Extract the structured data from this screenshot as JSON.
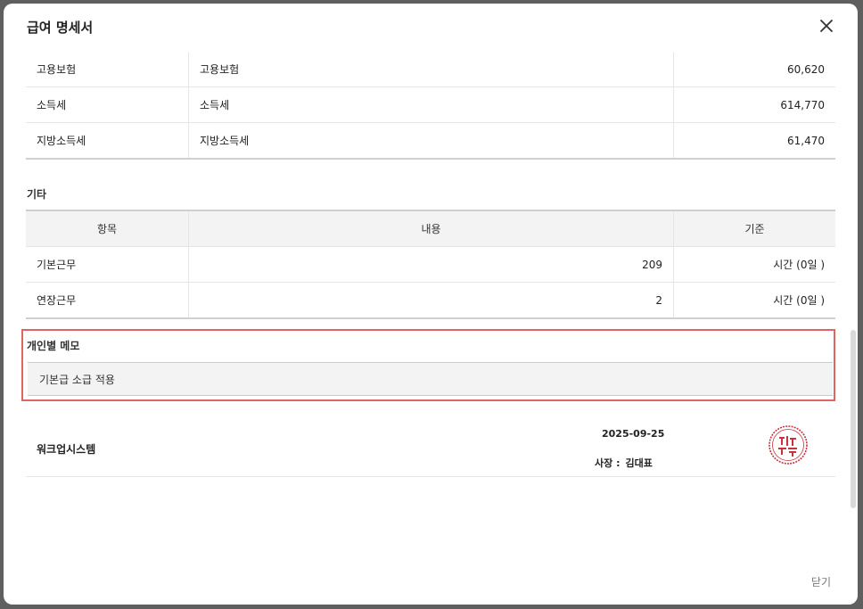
{
  "modal": {
    "title": "급여 명세서",
    "close_icon": "close-icon",
    "close_button_label": "닫기"
  },
  "deductions": {
    "rows": [
      {
        "category": "고용보험",
        "item": "고용보험",
        "amount": "60,620"
      },
      {
        "category": "소득세",
        "item": "소득세",
        "amount": "614,770"
      },
      {
        "category": "지방소득세",
        "item": "지방소득세",
        "amount": "61,470"
      }
    ]
  },
  "etc": {
    "label": "기타",
    "headers": [
      "항목",
      "내용",
      "기준"
    ],
    "rows": [
      {
        "item": "기본근무",
        "value": "209",
        "basis": "시간 (0일 )"
      },
      {
        "item": "연장근무",
        "value": "2",
        "basis": "시간 (0일 )"
      }
    ]
  },
  "memo": {
    "title": "개인별 메모",
    "content": "기본급 소급 적용"
  },
  "company": {
    "name": "워크업시스템",
    "date": "2025-09-25",
    "ceo_label": "사장 :",
    "ceo_name": "김대표",
    "seal_icon": "company-seal-icon"
  },
  "colors": {
    "highlight_border": "#e06464",
    "seal_red": "#c8323c"
  }
}
